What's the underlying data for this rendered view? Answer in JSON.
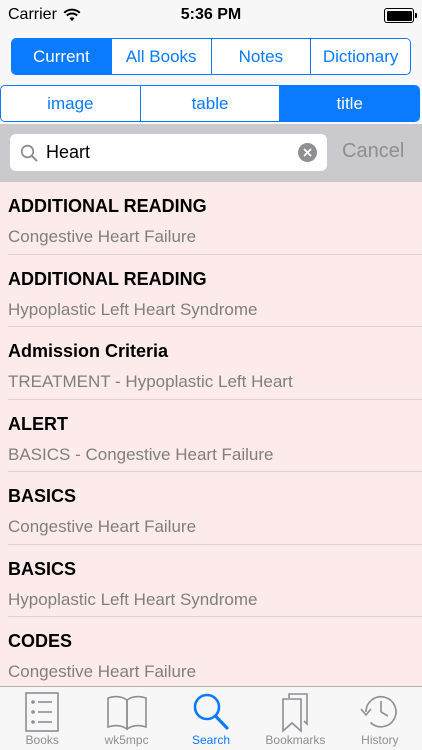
{
  "status_bar": {
    "carrier": "Carrier",
    "time": "5:36 PM"
  },
  "top_tabs": [
    {
      "label": "Current",
      "active": true
    },
    {
      "label": "All Books",
      "active": false
    },
    {
      "label": "Notes",
      "active": false
    },
    {
      "label": "Dictionary",
      "active": false
    }
  ],
  "filter_tabs": [
    {
      "label": "image",
      "active": false
    },
    {
      "label": "table",
      "active": false
    },
    {
      "label": "title",
      "active": true
    }
  ],
  "search": {
    "value": "Heart",
    "cancel_label": "Cancel"
  },
  "results": [
    {
      "title": "ADDITIONAL READING",
      "subtitle": "Congestive Heart Failure"
    },
    {
      "title": "ADDITIONAL READING",
      "subtitle": "Hypoplastic Left Heart Syndrome"
    },
    {
      "title": "Admission Criteria",
      "subtitle": "TREATMENT - Hypoplastic Left Heart"
    },
    {
      "title": "ALERT",
      "subtitle": "BASICS - Congestive Heart Failure"
    },
    {
      "title": "BASICS",
      "subtitle": "Congestive Heart Failure"
    },
    {
      "title": "BASICS",
      "subtitle": "Hypoplastic Left Heart Syndrome"
    },
    {
      "title": "CODES",
      "subtitle": "Congestive Heart Failure"
    }
  ],
  "tab_bar": [
    {
      "label": "Books",
      "icon": "list-icon",
      "active": false
    },
    {
      "label": "wk5mpc",
      "icon": "book-icon",
      "active": false
    },
    {
      "label": "Search",
      "icon": "search-icon",
      "active": true
    },
    {
      "label": "Bookmarks",
      "icon": "bookmarks-icon",
      "active": false
    },
    {
      "label": "History",
      "icon": "history-icon",
      "active": false
    }
  ],
  "colors": {
    "accent": "#0a7aff",
    "results_bg": "#fdeaea",
    "inactive": "#8e8e93"
  }
}
